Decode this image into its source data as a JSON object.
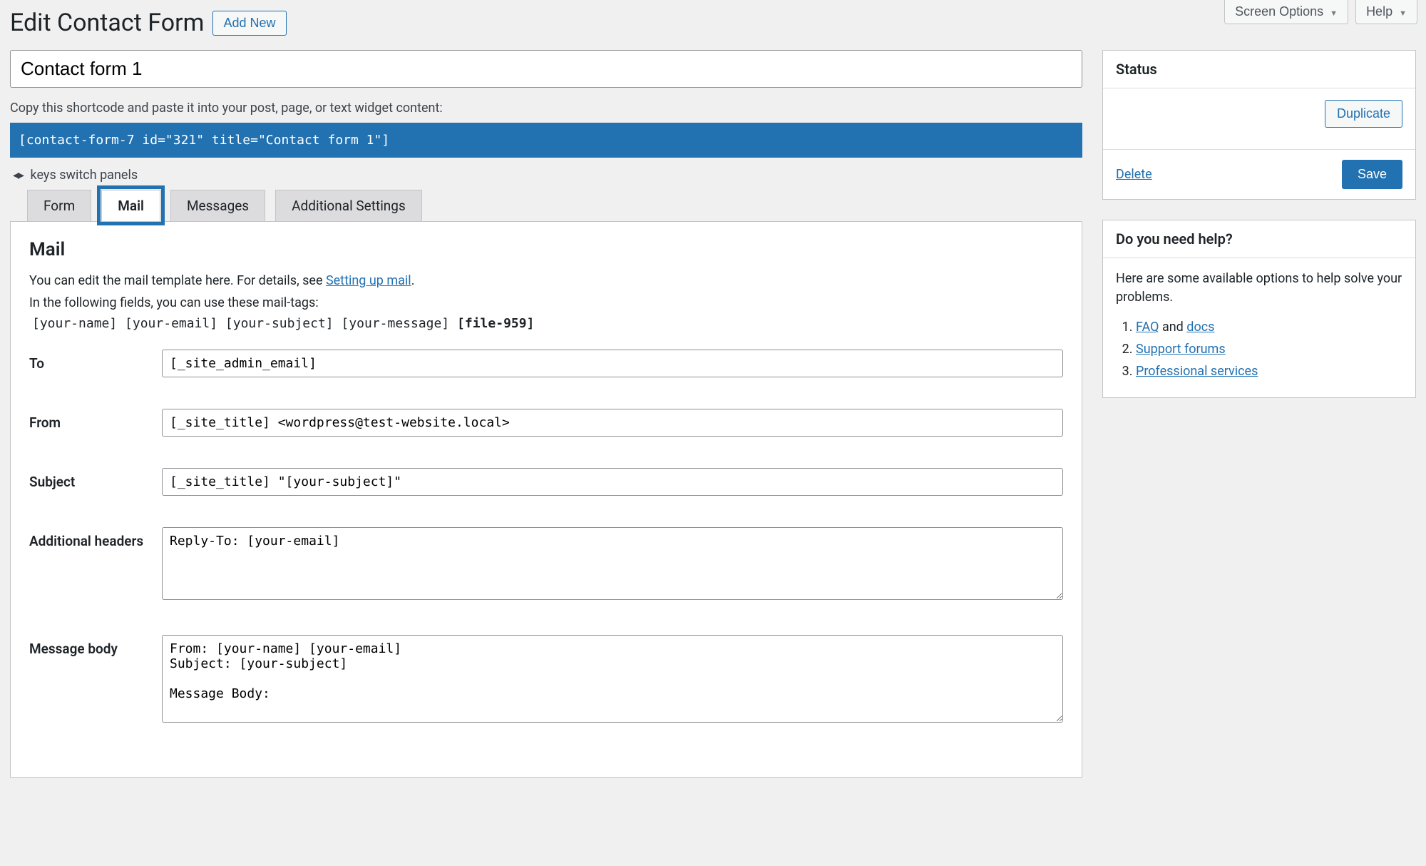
{
  "topbar": {
    "screen_options": "Screen Options",
    "help": "Help"
  },
  "header": {
    "title": "Edit Contact Form",
    "add_new": "Add New"
  },
  "form": {
    "title_value": "Contact form 1",
    "shortcode_label": "Copy this shortcode and paste it into your post, page, or text widget content:",
    "shortcode": "[contact-form-7 id=\"321\" title=\"Contact form 1\"]",
    "keys_hint": "keys switch panels"
  },
  "tabs": {
    "form": "Form",
    "mail": "Mail",
    "messages": "Messages",
    "additional": "Additional Settings"
  },
  "mail": {
    "heading": "Mail",
    "desc_pre": "You can edit the mail template here. For details, see ",
    "desc_link": "Setting up mail",
    "desc_post": ".",
    "desc2": "In the following fields, you can use these mail-tags:",
    "tags_plain": "[your-name] [your-email] [your-subject] [your-message]",
    "tags_bold": "[file-959]",
    "label_to": "To",
    "value_to": "[_site_admin_email]",
    "label_from": "From",
    "value_from": "[_site_title] <wordpress@test-website.local>",
    "label_subject": "Subject",
    "value_subject": "[_site_title] \"[your-subject]\"",
    "label_headers": "Additional headers",
    "value_headers": "Reply-To: [your-email]",
    "label_body": "Message body",
    "value_body": "From: [your-name] [your-email]\nSubject: [your-subject]\n\nMessage Body:"
  },
  "status": {
    "heading": "Status",
    "duplicate": "Duplicate",
    "delete": "Delete",
    "save": "Save"
  },
  "helpbox": {
    "heading": "Do you need help?",
    "intro": "Here are some available options to help solve your problems.",
    "faq": "FAQ",
    "and": " and ",
    "docs": "docs",
    "forums": "Support forums",
    "pro": "Professional services"
  }
}
